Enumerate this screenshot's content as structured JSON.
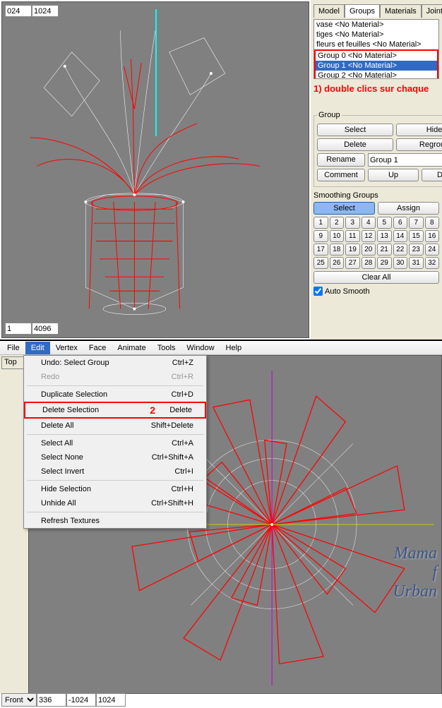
{
  "viewport_top": {
    "left_val": "024",
    "right_val": "1024",
    "bot_left": "1",
    "bot_right": "4096"
  },
  "tabs": {
    "model": "Model",
    "groups": "Groups",
    "materials": "Materials",
    "joints": "Joints"
  },
  "groups_list": [
    {
      "label": "vase <No Material>"
    },
    {
      "label": "tiges <No Material>"
    },
    {
      "label": "fleurs et feuilles <No Material>"
    },
    {
      "label": "Group 0 <No Material>",
      "boxed": true
    },
    {
      "label": "Group 1 <No Material>",
      "boxed": true,
      "selected": true
    },
    {
      "label": "Group 2 <No Material>",
      "boxed": true
    }
  ],
  "annotation1": "1) double clics sur chaque",
  "group_panel": {
    "legend": "Group",
    "select": "Select",
    "hide": "Hide",
    "delete": "Delete",
    "regroup": "Regroup",
    "rename": "Rename",
    "name_value": "Group 1",
    "comment": "Comment",
    "up": "Up",
    "down": "Down"
  },
  "smoothing": {
    "title": "Smoothing Groups",
    "select": "Select",
    "assign": "Assign",
    "nums": [
      "1",
      "2",
      "3",
      "4",
      "5",
      "6",
      "7",
      "8",
      "9",
      "10",
      "11",
      "12",
      "13",
      "14",
      "15",
      "16",
      "17",
      "18",
      "19",
      "20",
      "21",
      "22",
      "23",
      "24",
      "25",
      "26",
      "27",
      "28",
      "29",
      "30",
      "31",
      "32"
    ],
    "clear": "Clear All",
    "auto": "Auto Smooth"
  },
  "menu": {
    "file": "File",
    "edit": "Edit",
    "vertex": "Vertex",
    "face": "Face",
    "animate": "Animate",
    "tools": "Tools",
    "window": "Window",
    "help": "Help"
  },
  "view_label": "Top",
  "edit_menu": {
    "undo": {
      "l": "Undo: Select Group",
      "r": "Ctrl+Z"
    },
    "redo": {
      "l": "Redo",
      "r": "Ctrl+R"
    },
    "dup": {
      "l": "Duplicate Selection",
      "r": "Ctrl+D"
    },
    "del": {
      "l": "Delete Selection",
      "r": "Delete"
    },
    "delall": {
      "l": "Delete All",
      "r": "Shift+Delete"
    },
    "selall": {
      "l": "Select All",
      "r": "Ctrl+A"
    },
    "selnone": {
      "l": "Select None",
      "r": "Ctrl+Shift+A"
    },
    "selinv": {
      "l": "Select Invert",
      "r": "Ctrl+I"
    },
    "hide": {
      "l": "Hide Selection",
      "r": "Ctrl+H"
    },
    "unhide": {
      "l": "Unhide All",
      "r": "Ctrl+Shift+H"
    },
    "refresh": {
      "l": "Refresh Textures",
      "r": ""
    }
  },
  "annotation2": "2",
  "bot_inputs": {
    "view": "Front",
    "a": "336",
    "b": "-1024",
    "c": "1024"
  },
  "watermark": {
    "l1": "Mama",
    "l2": "f",
    "l3": "Urban"
  }
}
